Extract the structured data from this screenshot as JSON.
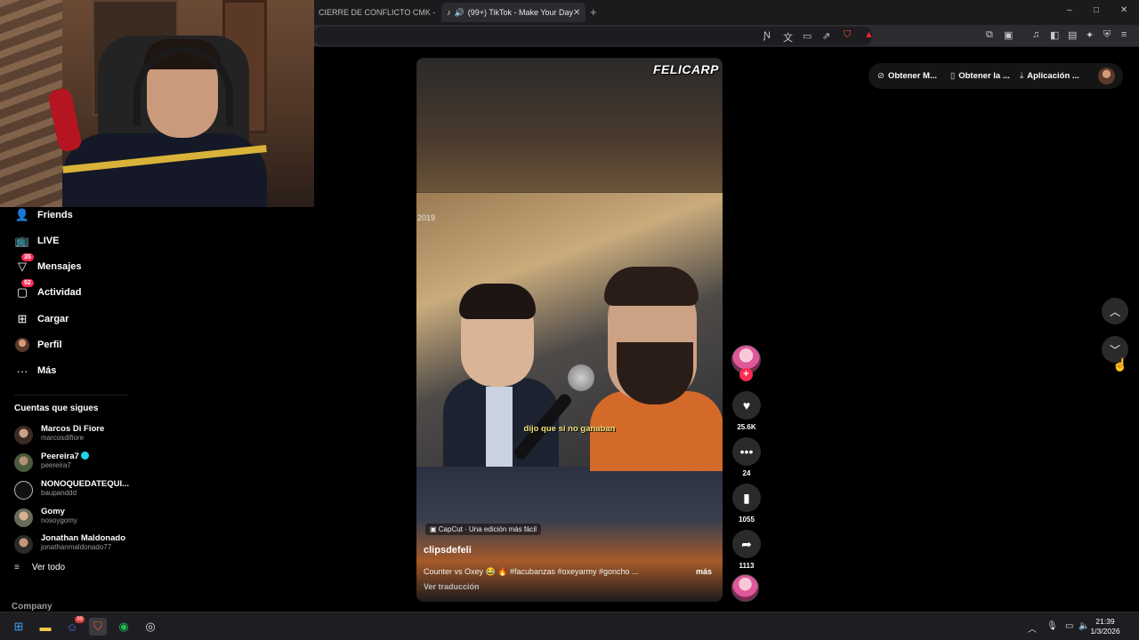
{
  "browser": {
    "tabs": [
      {
        "title": "CIERRE DE CONFLICTO CMK - SHARI",
        "active": false
      },
      {
        "title": "(99+) TikTok - Make Your Day",
        "active": true
      }
    ],
    "new_tab": "+",
    "window_controls": {
      "minimize": "–",
      "maximize": "□",
      "close": "✕"
    }
  },
  "sidebar": {
    "items": [
      {
        "label": "Friends",
        "icon": "friends-icon",
        "badge": ""
      },
      {
        "label": "LIVE",
        "icon": "live-icon",
        "badge": ""
      },
      {
        "label": "Mensajes",
        "icon": "messages-icon",
        "badge": "35"
      },
      {
        "label": "Actividad",
        "icon": "activity-icon",
        "badge": "92"
      },
      {
        "label": "Cargar",
        "icon": "upload-icon",
        "badge": ""
      },
      {
        "label": "Perfil",
        "icon": "profile-avatar",
        "badge": ""
      },
      {
        "label": "Más",
        "icon": "more-icon",
        "badge": ""
      }
    ],
    "following_title": "Cuentas que sigues",
    "following": [
      {
        "name": "Marcos Di Fiore",
        "username": "marcosdifiore",
        "verified": false
      },
      {
        "name": "Peereira7",
        "username": "peereira7",
        "verified": true
      },
      {
        "name": "NONOQUEDATEQUI...",
        "username": "baupanddd",
        "verified": false
      },
      {
        "name": "Gomy",
        "username": "nosoygomy",
        "verified": false
      },
      {
        "name": "Jonathan Maldonado",
        "username": "jonathanmaldonado77",
        "verified": false
      }
    ],
    "see_all": "Ver todo",
    "company": "Company"
  },
  "video": {
    "watermark": "FELICARP",
    "year": "2019",
    "subtitle": "dijo que si no ganaban",
    "capcut": "CapCut · Una edición más fácil",
    "author": "clipsdefeli",
    "description": "Counter vs  Oxey 😂 🔥 #facubanzas #oxeyarmy #goncho ...",
    "more": "más",
    "translate": "Ver traducción"
  },
  "actions": {
    "likes": "25.6K",
    "comments": "24",
    "saves": "1055",
    "shares": "1113"
  },
  "top_right": {
    "items": [
      {
        "label": "Obtener M...",
        "icon": "coin-icon"
      },
      {
        "label": "Obtener la ...",
        "icon": "phone-icon"
      },
      {
        "label": "Aplicación ...",
        "icon": "download-icon"
      }
    ]
  },
  "taskbar": {
    "time": "21:39",
    "date": "1/3/2026",
    "discord_badge": "99"
  },
  "colors": {
    "accent": "#fe2c55",
    "background": "#000000",
    "subtitle": "#f3e27a"
  }
}
